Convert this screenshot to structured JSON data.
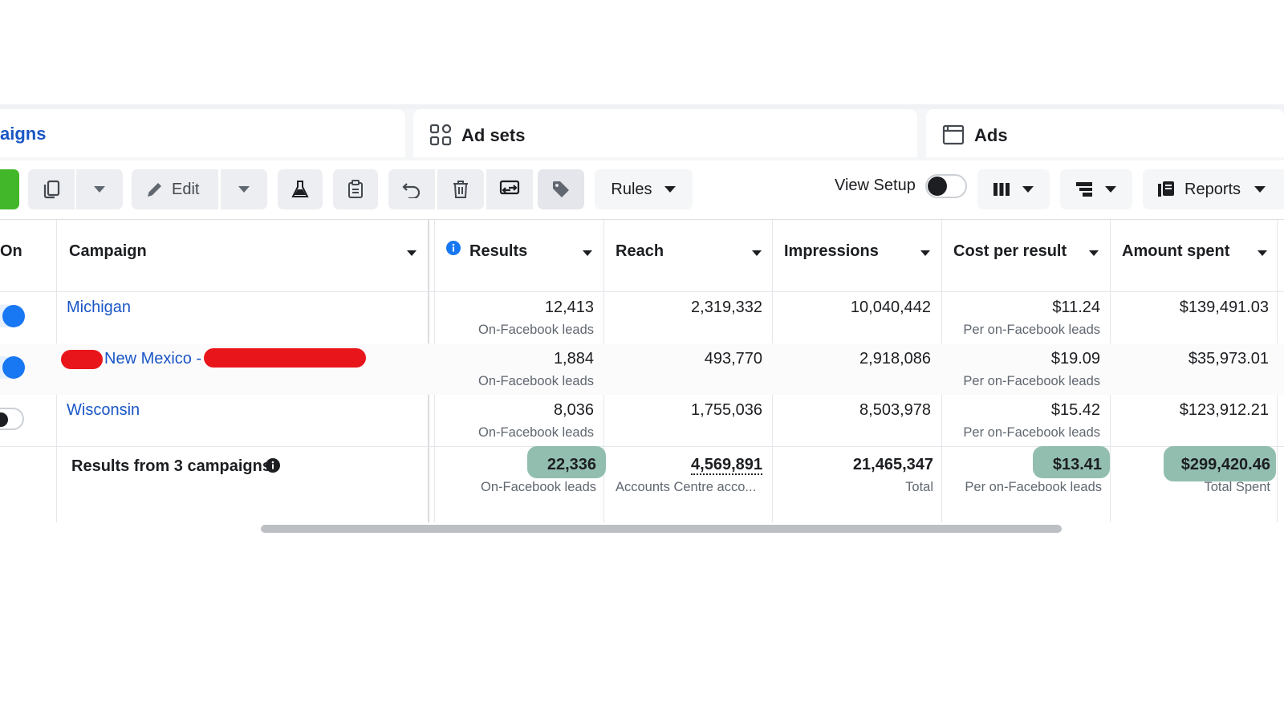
{
  "tabs": {
    "campaigns": "aigns",
    "adsets": "Ad sets",
    "ads": "Ads"
  },
  "toolbar": {
    "edit_label": "Edit",
    "rules_label": "Rules",
    "view_setup_label": "View Setup",
    "reports_label": "Reports"
  },
  "columns": {
    "on": "On",
    "campaign": "Campaign",
    "results": "Results",
    "reach": "Reach",
    "impressions": "Impressions",
    "cost_per_result": "Cost per result",
    "amount_spent": "Amount spent"
  },
  "rows": [
    {
      "name": "Michigan",
      "results": "12,413",
      "results_sub": "On-Facebook leads",
      "reach": "2,319,332",
      "impressions": "10,040,442",
      "cost": "$11.24",
      "cost_sub": "Per on-Facebook leads",
      "spent": "$139,491.03",
      "toggle_on": true
    },
    {
      "name": "New Mexico -",
      "results": "1,884",
      "results_sub": "On-Facebook leads",
      "reach": "493,770",
      "impressions": "2,918,086",
      "cost": "$19.09",
      "cost_sub": "Per on-Facebook leads",
      "spent": "$35,973.01",
      "toggle_on": true
    },
    {
      "name": "Wisconsin",
      "results": "8,036",
      "results_sub": "On-Facebook leads",
      "reach": "1,755,036",
      "impressions": "8,503,978",
      "cost": "$15.42",
      "cost_sub": "Per on-Facebook leads",
      "spent": "$123,912.21",
      "toggle_on": false
    }
  ],
  "summary": {
    "label": "Results from 3 campaigns",
    "results": "22,336",
    "results_sub": "On-Facebook leads",
    "reach": "4,569,891",
    "reach_sub": "Accounts Centre acco...",
    "impressions": "21,465,347",
    "impressions_sub": "Total",
    "cost": "$13.41",
    "cost_sub": "Per on-Facebook leads",
    "spent": "$299,420.46",
    "spent_sub": "Total Spent"
  },
  "colors": {
    "link": "#1a56c6",
    "toggle_on": "#1877f2",
    "highlight": "#7fb3a2",
    "redaction": "#e8161b",
    "create_button": "#42b72a"
  },
  "icons": [
    "duplicate-icon",
    "chevron-down-icon",
    "pencil-icon",
    "flask-icon",
    "clipboard-icon",
    "undo-icon",
    "trash-icon",
    "sync-icon",
    "tag-icon",
    "columns-icon",
    "breakdown-icon",
    "reports-icon",
    "info-icon",
    "grid-icon",
    "ad-frame-icon"
  ]
}
